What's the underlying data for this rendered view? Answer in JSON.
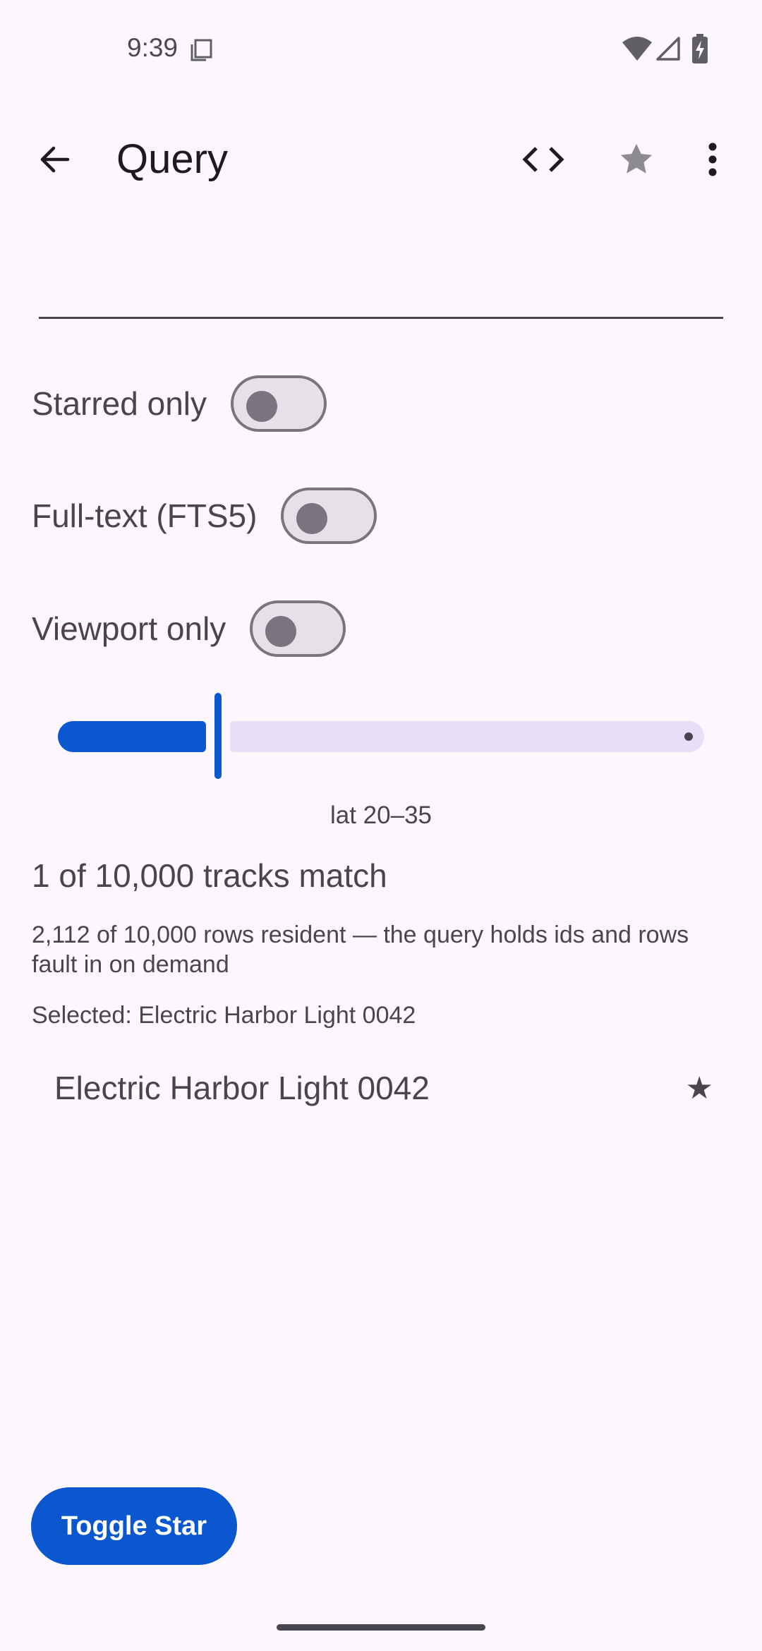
{
  "status_bar": {
    "time": "9:39",
    "icons": [
      "copy-icon",
      "wifi-icon",
      "signal-icon",
      "battery-charging-icon"
    ]
  },
  "app_bar": {
    "title": "Query",
    "back_icon": "arrow-back-icon",
    "actions": [
      "code-icon",
      "star-icon",
      "more-vert-icon"
    ]
  },
  "search": {
    "value": "",
    "placeholder": ""
  },
  "filters": [
    {
      "label": "Starred only",
      "on": false
    },
    {
      "label": "Full-text (FTS5)",
      "on": false
    },
    {
      "label": "Viewport only",
      "on": false
    }
  ],
  "slider": {
    "caption": "lat 20–35",
    "value_fraction": 0.25
  },
  "results": {
    "match_count": "1 of 10,000 tracks match",
    "resident_note": "2,112 of 10,000 rows resident — the query holds ids and rows fault in on demand",
    "selected": "Selected: Electric Harbor Light 0042",
    "items": [
      {
        "title": "Electric Harbor Light 0042",
        "star": "★"
      }
    ]
  },
  "actions": {
    "toggle_star_label": "Toggle Star"
  },
  "colors": {
    "background": "#fdf7fd",
    "primary": "#0b57d0",
    "slider_inactive": "#e8def8",
    "switch_track": "#e6e0e9",
    "switch_outline": "#79747e",
    "text_secondary": "#49454f"
  }
}
